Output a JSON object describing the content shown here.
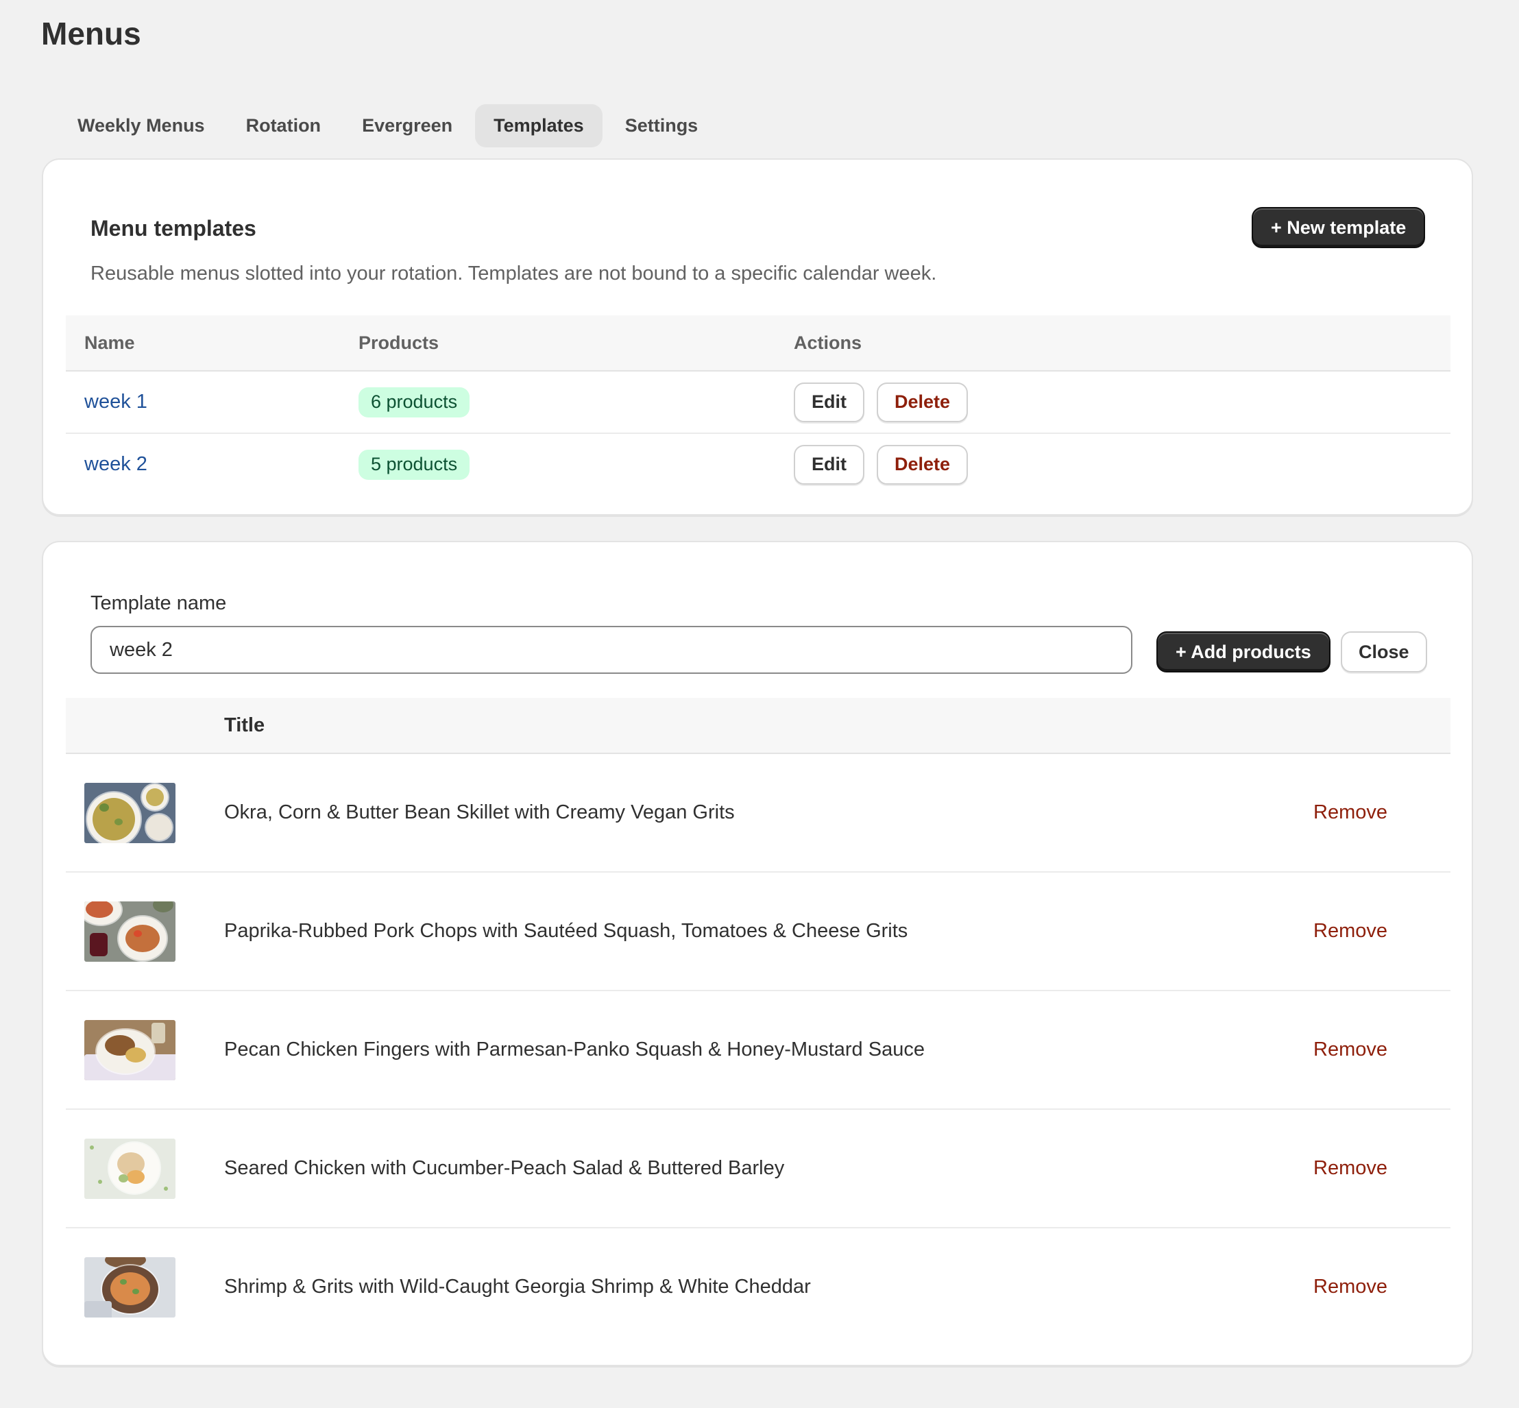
{
  "page": {
    "title": "Menus"
  },
  "tabs": [
    {
      "label": "Weekly Menus",
      "active": false
    },
    {
      "label": "Rotation",
      "active": false
    },
    {
      "label": "Evergreen",
      "active": false
    },
    {
      "label": "Templates",
      "active": true
    },
    {
      "label": "Settings",
      "active": false
    }
  ],
  "templates": {
    "title": "Menu templates",
    "description": "Reusable menus slotted into your rotation. Templates are not bound to a specific calendar week.",
    "new_button": "+ New template",
    "columns": {
      "name": "Name",
      "products": "Products",
      "actions": "Actions"
    },
    "rows": [
      {
        "name": "week 1",
        "products": "6 products",
        "edit": "Edit",
        "delete": "Delete"
      },
      {
        "name": "week 2",
        "products": "5 products",
        "edit": "Edit",
        "delete": "Delete"
      }
    ]
  },
  "editor": {
    "field_label": "Template name",
    "name_value": "week 2",
    "add_button": "+ Add products",
    "close_button": "Close",
    "columns": {
      "title": "Title"
    },
    "products": [
      {
        "title": "Okra, Corn & Butter Bean Skillet with Creamy Vegan Grits",
        "remove": "Remove"
      },
      {
        "title": "Paprika-Rubbed Pork Chops with Sautéed Squash, Tomatoes & Cheese Grits",
        "remove": "Remove"
      },
      {
        "title": "Pecan Chicken Fingers with Parmesan-Panko Squash & Honey-Mustard Sauce",
        "remove": "Remove"
      },
      {
        "title": "Seared Chicken with Cucumber-Peach Salad & Buttered Barley",
        "remove": "Remove"
      },
      {
        "title": "Shrimp & Grits with Wild-Caught Georgia Shrimp & White Cheddar",
        "remove": "Remove"
      }
    ]
  },
  "colors": {
    "link": "#1f5199",
    "danger": "#8e1f0b",
    "badge_bg": "#cdfee1",
    "badge_text": "#0c5132",
    "primary_button": "#303030"
  }
}
